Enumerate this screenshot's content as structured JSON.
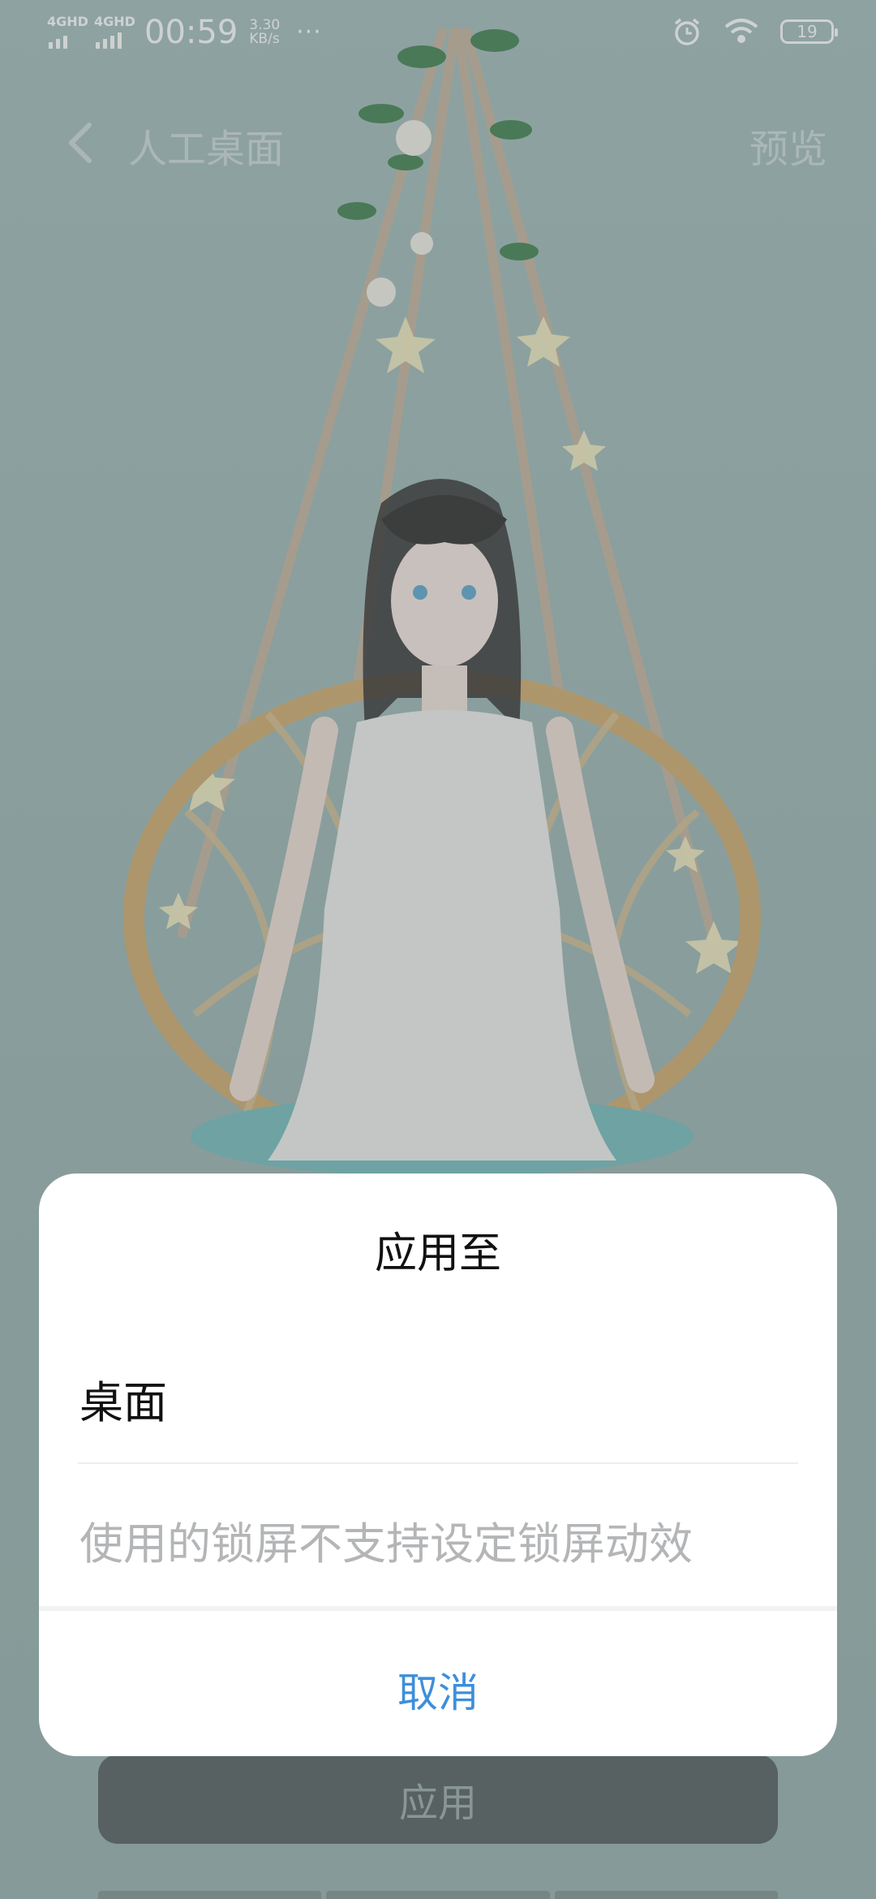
{
  "status_bar": {
    "network1": "4GHD",
    "network2": "4GHD",
    "time": "00:59",
    "speed_value": "3.30",
    "speed_unit": "KB/s",
    "more": "···",
    "battery": "19"
  },
  "header": {
    "title": "人工桌面",
    "preview_label": "预览"
  },
  "dialog": {
    "title": "应用至",
    "option_desktop": "桌面",
    "option_lockscreen_disabled": "使用的锁屏不支持设定锁屏动效",
    "cancel_label": "取消"
  },
  "footer": {
    "apply_label": "应用"
  },
  "colors": {
    "accent": "#3d8fdb",
    "background": "#a8bfbd",
    "apply_button": "#606a6b"
  }
}
